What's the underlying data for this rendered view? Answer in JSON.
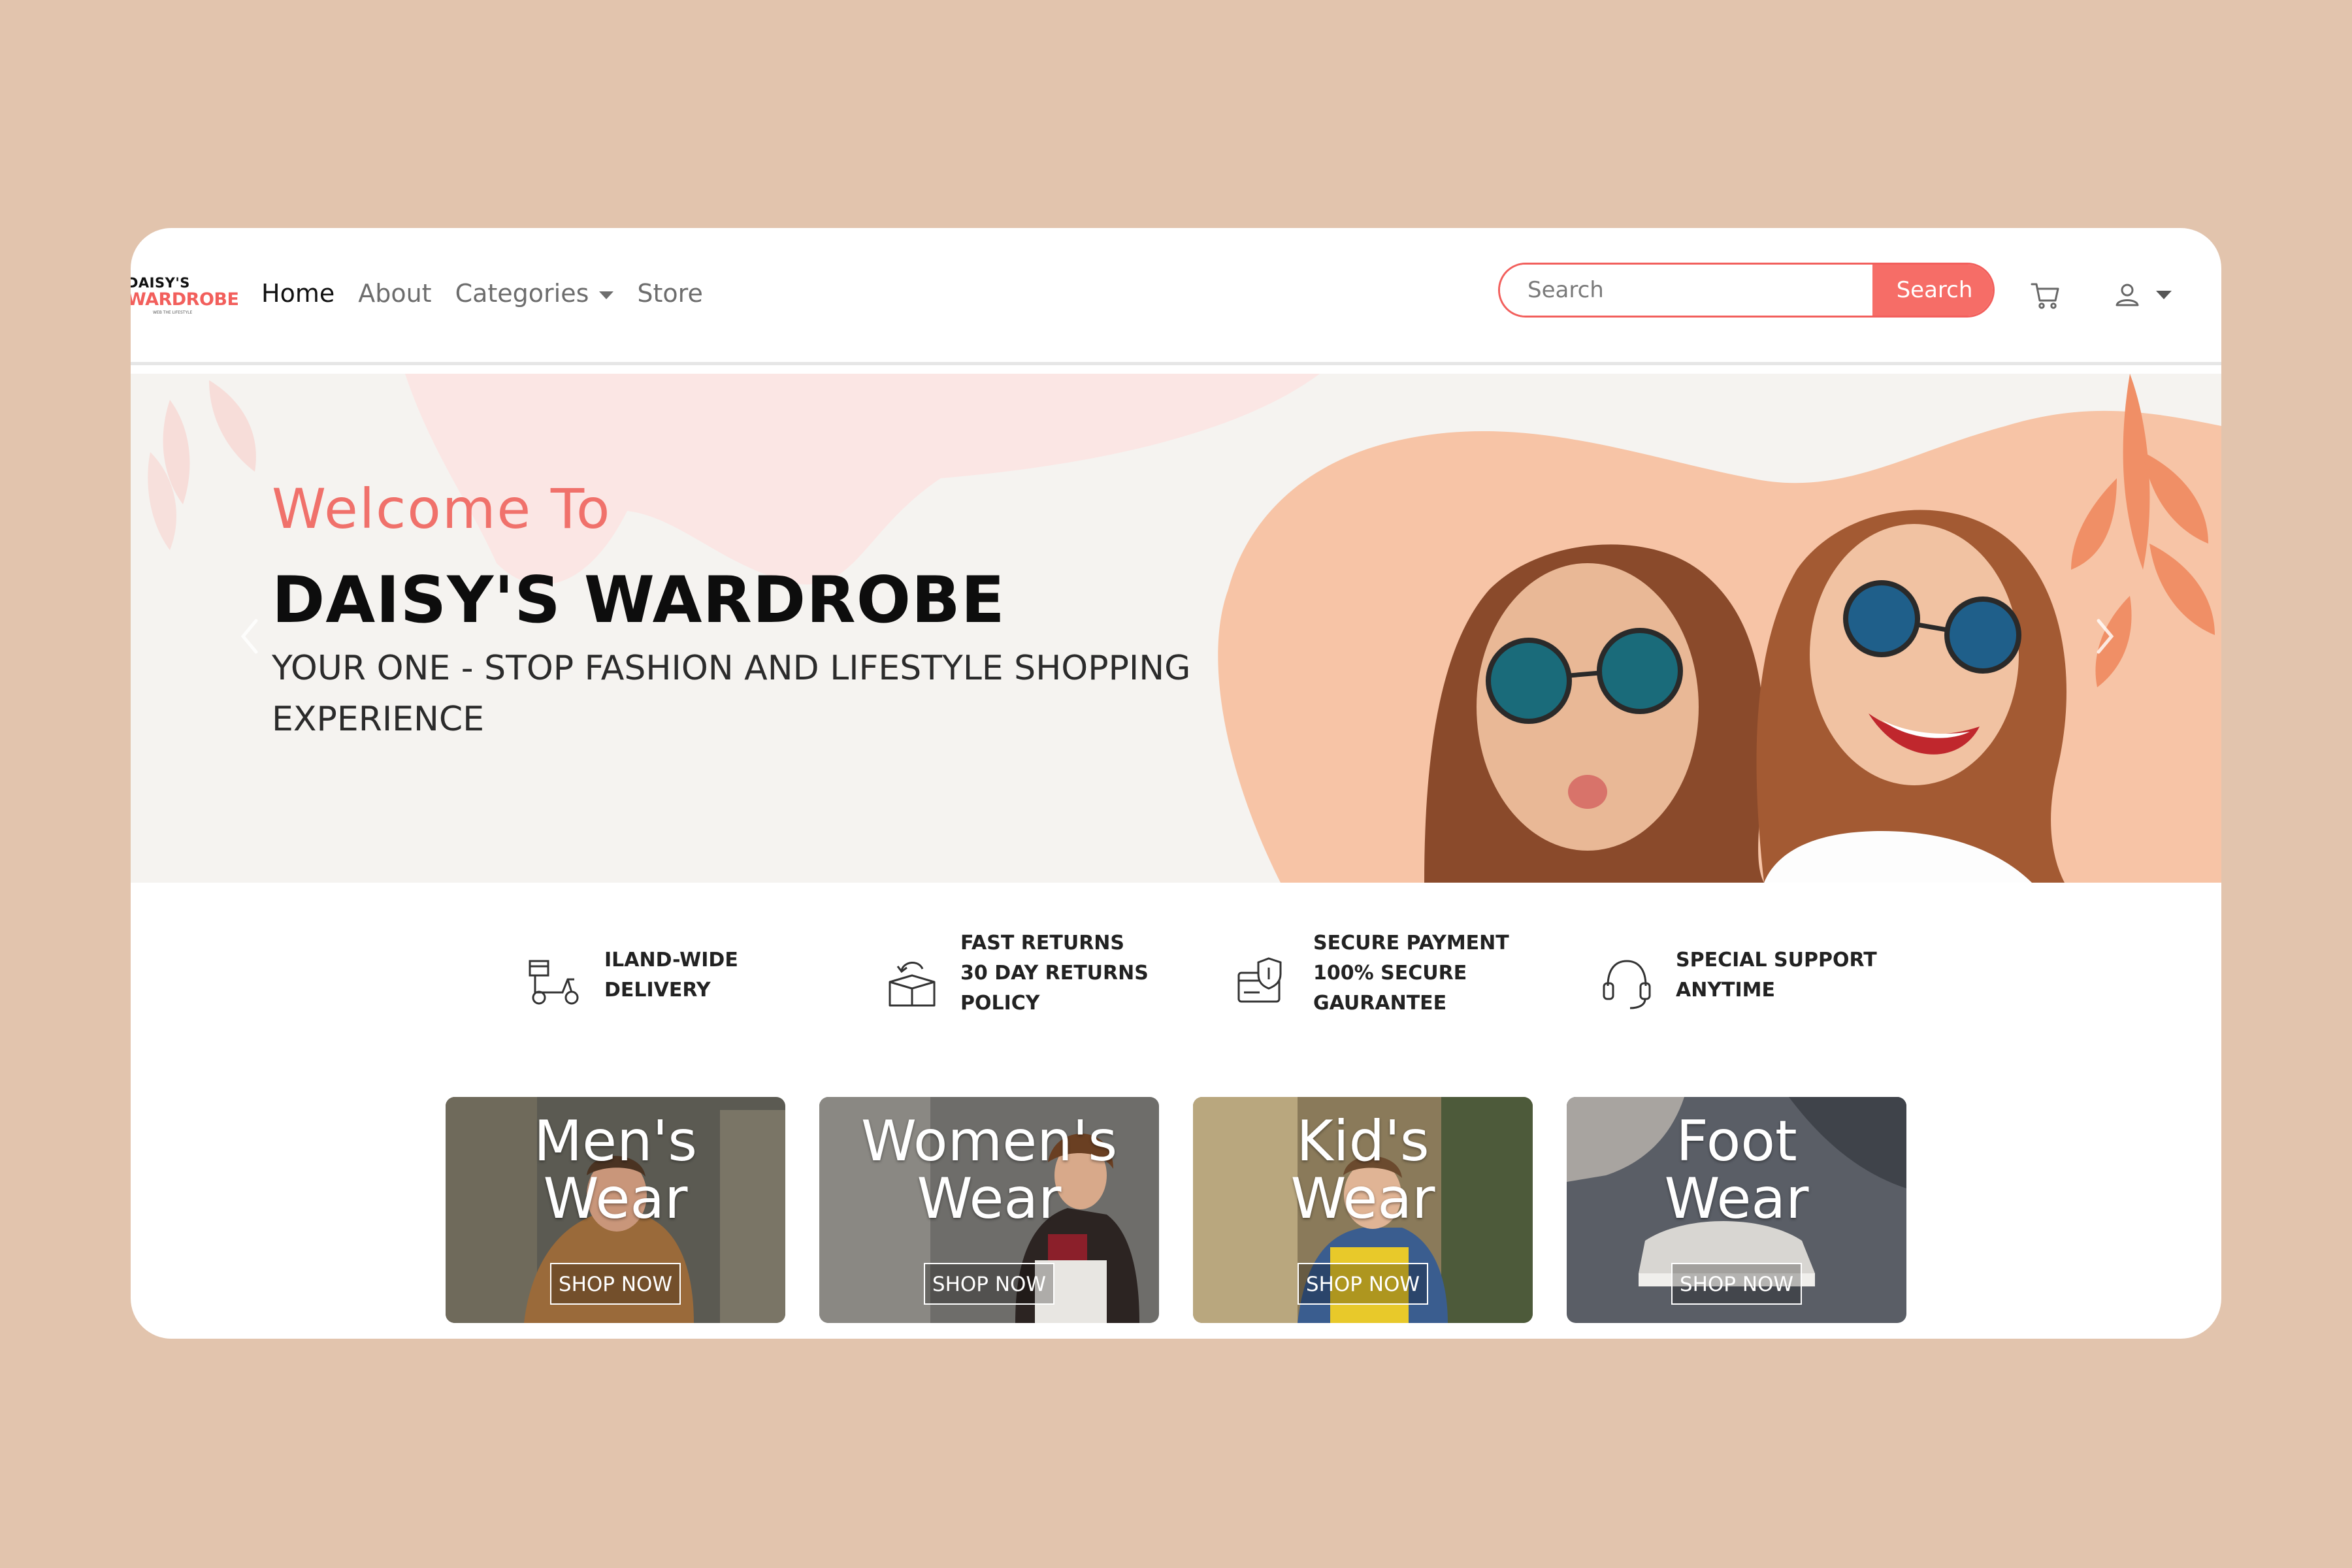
{
  "brand": {
    "logo_line1": "DAISY'S",
    "logo_line2": "WARDROBE",
    "logo_tagline": "WEB THE LIFESTYLE"
  },
  "nav": {
    "items": [
      {
        "label": "Home"
      },
      {
        "label": "About"
      },
      {
        "label": "Categories"
      },
      {
        "label": "Store"
      }
    ]
  },
  "search": {
    "placeholder": "Search",
    "button_label": "Search"
  },
  "icons": {
    "cart": "cart-icon",
    "user": "user-icon",
    "menu_caret": "chevron-down-icon",
    "carousel_prev": "chevron-left-icon",
    "carousel_next": "chevron-right-icon"
  },
  "hero": {
    "welcome": "Welcome To",
    "title": "DAISY'S WARDROBE",
    "tagline": "YOUR ONE - STOP FASHION AND LIFESTYLE SHOPPING EXPERIENCE"
  },
  "features": [
    {
      "icon": "delivery-scooter-icon",
      "text": "ILAND-WIDE\nDELIVERY"
    },
    {
      "icon": "return-box-icon",
      "text": "FAST RETURNS\n30 DAY RETURNS\nPOLICY"
    },
    {
      "icon": "secure-card-icon",
      "text": "SECURE PAYMENT\n100% SECURE\nGAURANTEE"
    },
    {
      "icon": "headset-icon",
      "text": "SPECIAL SUPPORT\nANYTIME"
    }
  ],
  "categories": [
    {
      "title": "Men's\nWear",
      "button": "SHOP NOW"
    },
    {
      "title": "Women's\nWear",
      "button": "SHOP NOW"
    },
    {
      "title": "Kid's\nWear",
      "button": "SHOP NOW"
    },
    {
      "title": "Foot\nWear",
      "button": "SHOP NOW"
    }
  ],
  "colors": {
    "page_background": "#e2c4ad",
    "accent": "#f25f5c",
    "hero_background": "#f5f3f0",
    "hero_blob": "#f7c4a6"
  }
}
